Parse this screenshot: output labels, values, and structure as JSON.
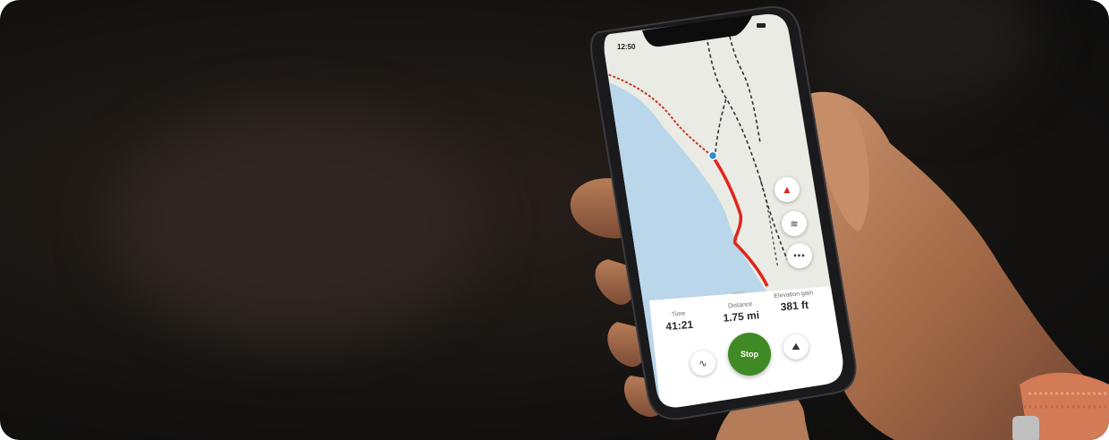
{
  "status_bar": {
    "time": "12:50"
  },
  "stats": {
    "time": {
      "label": "Time",
      "value": "41:21"
    },
    "distance": {
      "label": "Distance",
      "value": "1.75 mi"
    },
    "elevation": {
      "label": "Elevation gain",
      "value": "381 ft"
    }
  },
  "controls": {
    "stop_label": "Stop"
  },
  "icons": {
    "compass": "compass-icon",
    "layers": "layers-icon",
    "more": "more-icon",
    "chart": "elevation-chart-icon",
    "hiker": "hiker-icon"
  },
  "colors": {
    "route": "#e0251b",
    "stop": "#3f8a24",
    "water": "#b9d6ea",
    "land": "#e9ebe4"
  }
}
